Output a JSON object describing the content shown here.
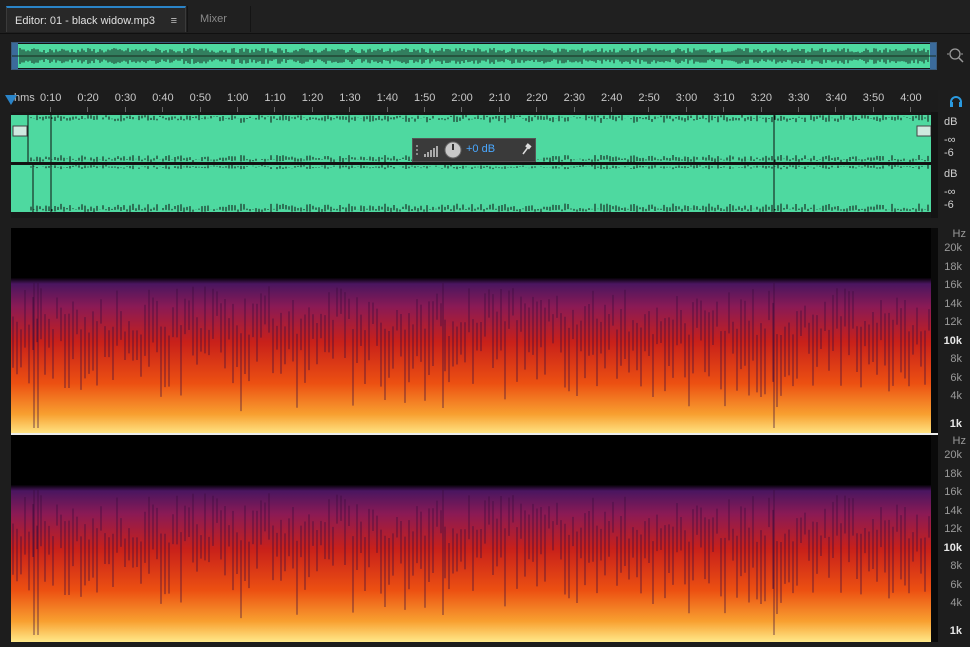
{
  "tabs": [
    {
      "label": "Editor: 01 - black widow.mp3",
      "active": true
    },
    {
      "label": "Mixer",
      "active": false
    }
  ],
  "tab_menu_icon": "≡",
  "ruler": {
    "format_label": "hms",
    "labels": [
      "0:10",
      "0:20",
      "0:30",
      "0:40",
      "0:50",
      "1:00",
      "1:10",
      "1:20",
      "1:30",
      "1:40",
      "1:50",
      "2:00",
      "2:10",
      "2:20",
      "2:30",
      "2:40",
      "2:50",
      "3:00",
      "3:10",
      "3:20",
      "3:30",
      "3:40",
      "3:50",
      "4:00"
    ]
  },
  "hud": {
    "volume_label": "+0 dB"
  },
  "amplitude_scale": {
    "channel_1": {
      "unit": "dB",
      "inf": "-∞",
      "val": "-6"
    },
    "channel_2": {
      "unit": "dB",
      "inf": "-∞",
      "val": "-6"
    }
  },
  "frequency_scale": {
    "unit": "Hz",
    "labels": [
      "20k",
      "18k",
      "16k",
      "14k",
      "12k",
      "10k",
      "8k",
      "6k",
      "4k",
      "1k"
    ]
  },
  "colors": {
    "waveform": "#4ed9a0",
    "accent": "#2a84c8",
    "spectrum_low": "#ffe770",
    "spectrum_mid": "#e8340e",
    "spectrum_high": "#5a1a6a"
  },
  "icons": {
    "zoom": "zoom-magnifier-icon",
    "headphones": "headphones-icon",
    "pin": "pin-icon",
    "knob": "volume-knob-icon"
  }
}
